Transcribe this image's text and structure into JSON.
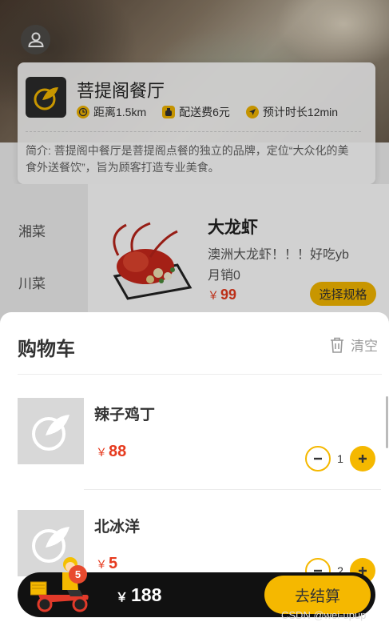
{
  "shop": {
    "name": "菩提阁餐厅",
    "distance": "距离1.5km",
    "delivery_fee": "配送费6元",
    "delivery_time": "预计时长12min",
    "description": "简介: 菩提阁中餐厅是菩提阁点餐的独立的品牌，定位“大众化的美食外送餐饮”，旨为顾客打造专业美食。"
  },
  "categories": [
    "湘菜",
    "川菜"
  ],
  "dish": {
    "name": "大龙虾",
    "description": "澳洲大龙虾！！！好吃yb",
    "sales": "月销0",
    "currency": "￥",
    "price": "99",
    "spec_button": "选择规格"
  },
  "cart": {
    "title": "购物车",
    "clear_label": "清空",
    "items": [
      {
        "name": "辣子鸡丁",
        "currency": "￥",
        "price": "88",
        "quantity": "1"
      },
      {
        "name": "北冰洋",
        "currency": "￥",
        "price": "5",
        "quantity": "2"
      }
    ]
  },
  "bottom_bar": {
    "badge_count": "5",
    "currency": "￥",
    "total": "188",
    "checkout_label": "去结算"
  },
  "watermark": "CSDN @wei-upup",
  "colors": {
    "accent": "#f5b800",
    "price": "#e63a1e",
    "bar": "#111111"
  }
}
